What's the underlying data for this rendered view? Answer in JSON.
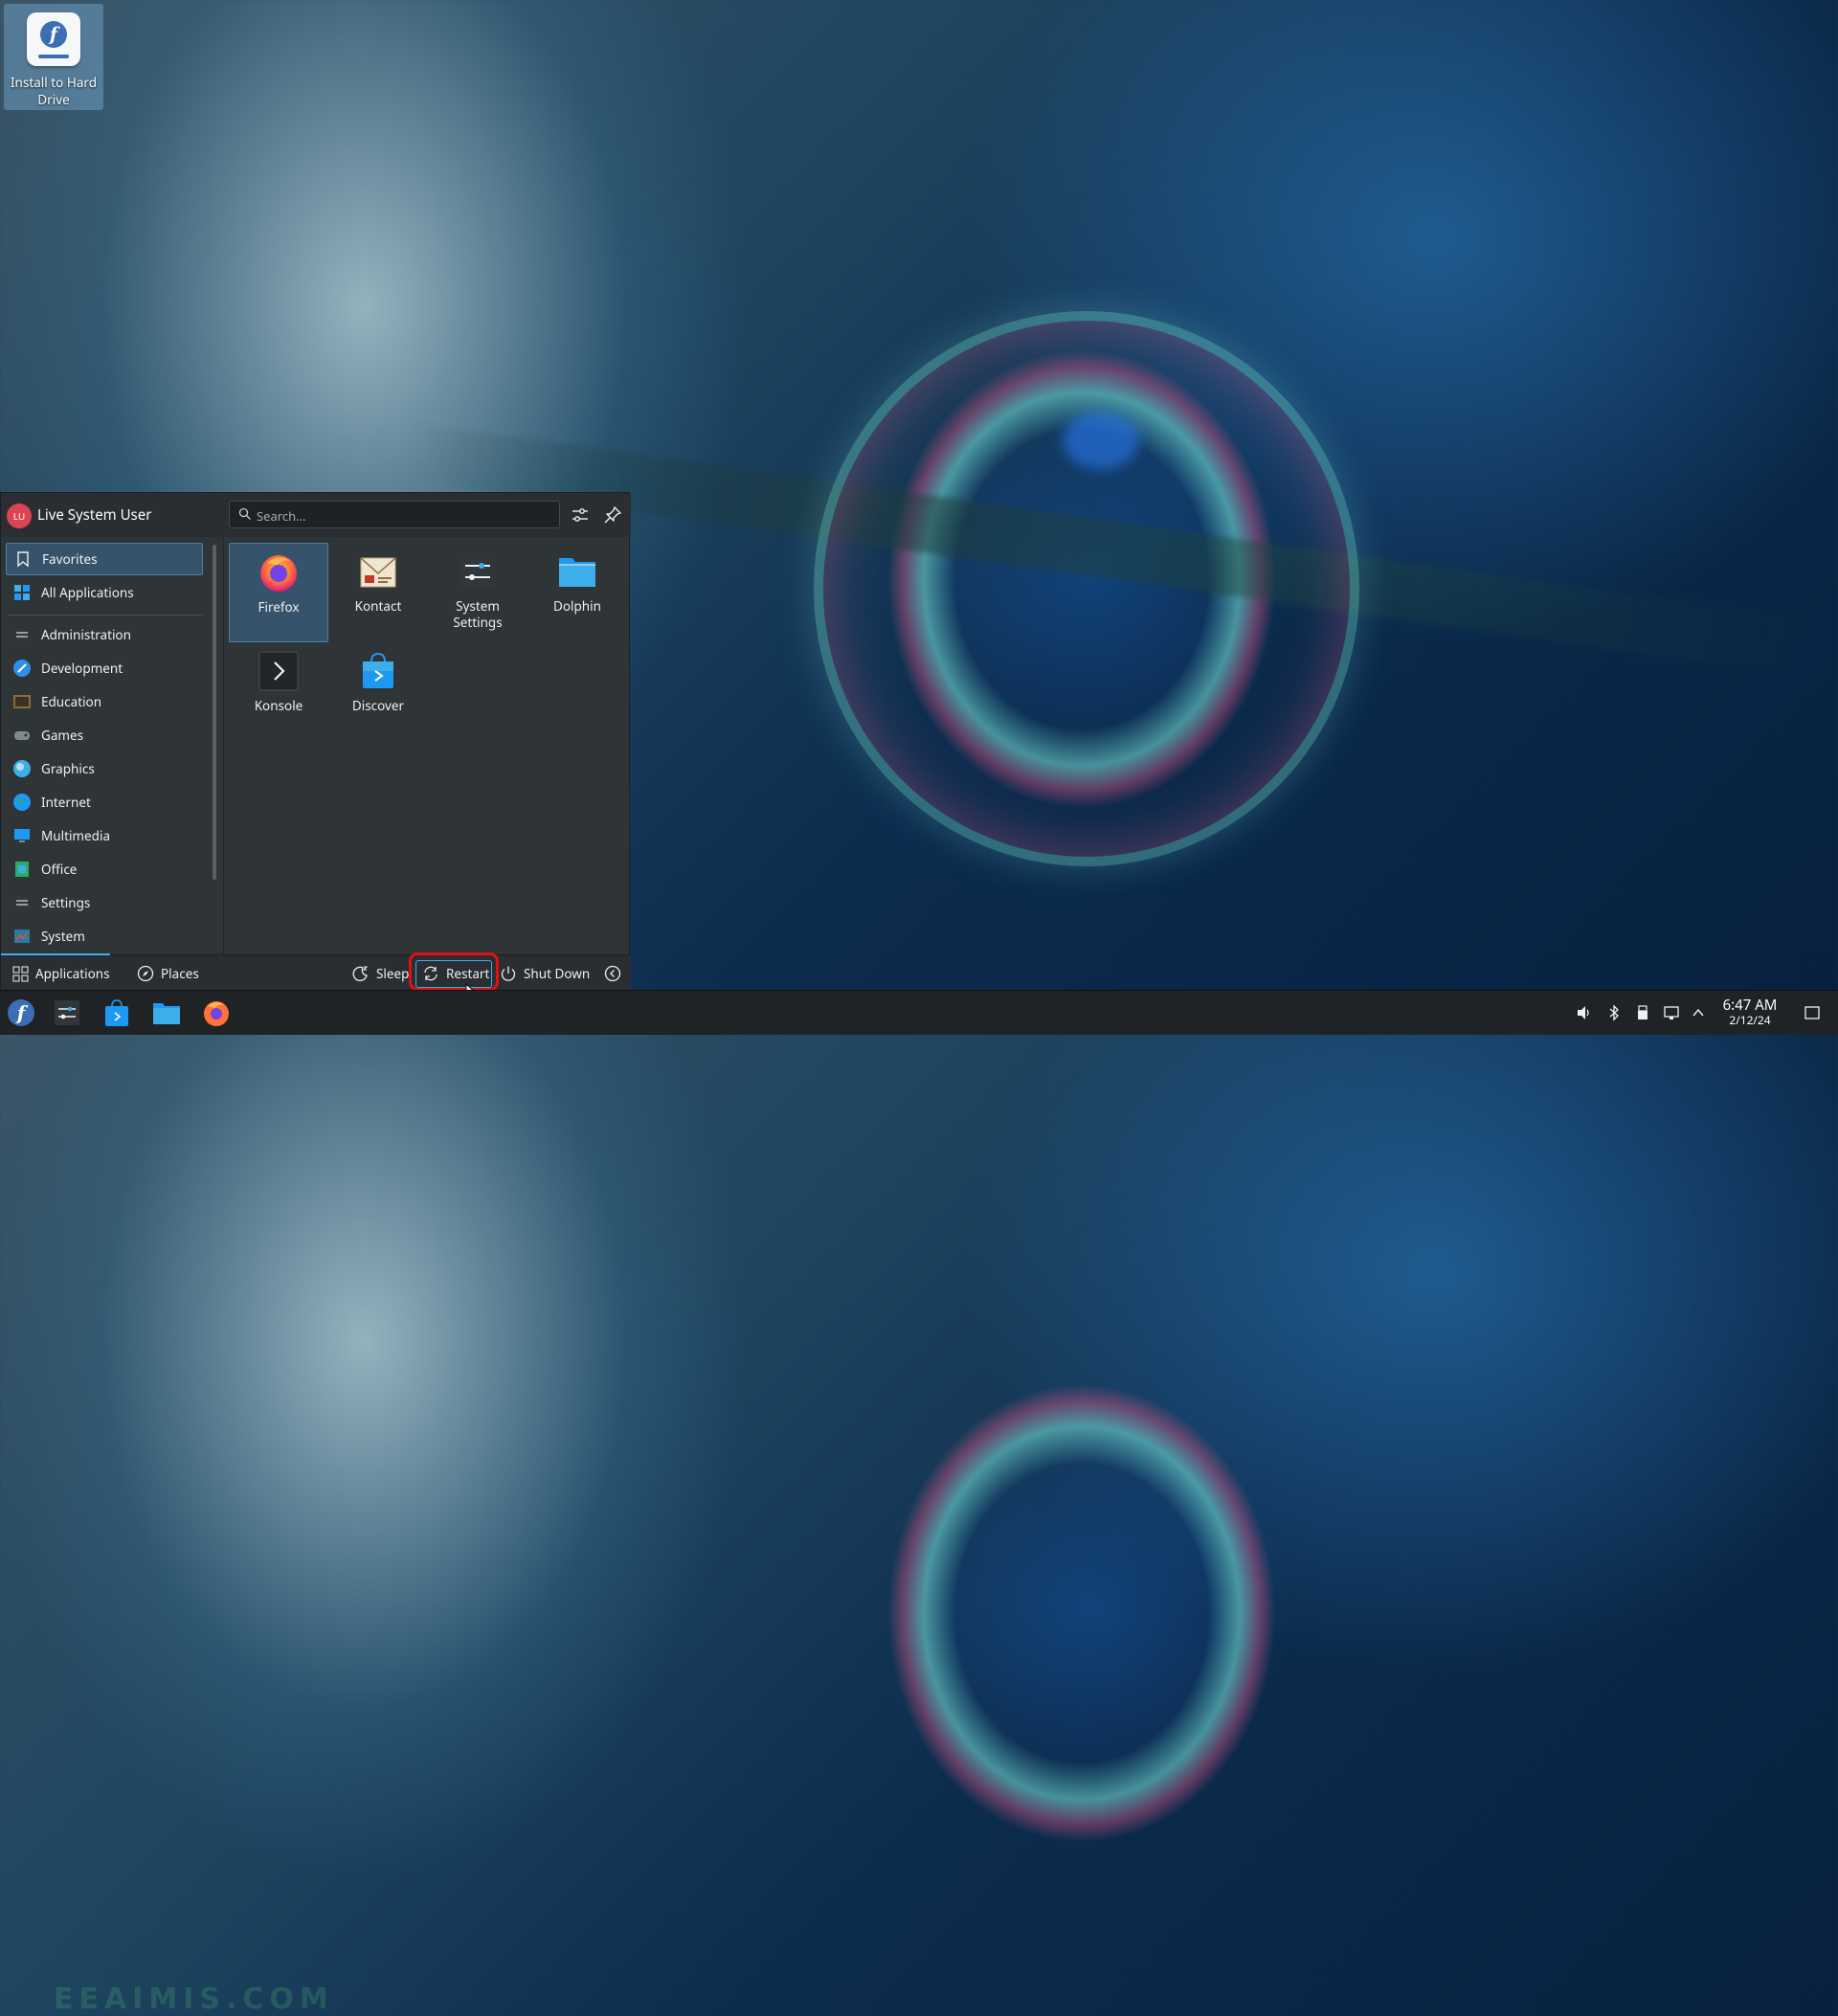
{
  "desktop": {
    "icons": [
      {
        "label": "Install to Hard Drive"
      }
    ]
  },
  "launcher": {
    "user": {
      "initials": "LU",
      "name": "Live System User"
    },
    "search": {
      "placeholder": "Search..."
    },
    "sidebar": {
      "items": [
        {
          "label": "Favorites",
          "icon": "bookmark-icon",
          "active": true
        },
        {
          "label": "All Applications",
          "icon": "grid-icon"
        },
        {
          "label": "Administration",
          "icon": "admin-icon"
        },
        {
          "label": "Development",
          "icon": "development-icon"
        },
        {
          "label": "Education",
          "icon": "education-icon"
        },
        {
          "label": "Games",
          "icon": "gamepad-icon"
        },
        {
          "label": "Graphics",
          "icon": "graphics-icon"
        },
        {
          "label": "Internet",
          "icon": "globe-icon"
        },
        {
          "label": "Multimedia",
          "icon": "multimedia-icon"
        },
        {
          "label": "Office",
          "icon": "office-icon"
        },
        {
          "label": "Settings",
          "icon": "settings-icon"
        },
        {
          "label": "System",
          "icon": "system-icon"
        }
      ]
    },
    "favorites": [
      {
        "label": "Firefox",
        "icon": "firefox-icon",
        "active": true
      },
      {
        "label": "Kontact",
        "icon": "kontact-icon"
      },
      {
        "label": "System Settings",
        "icon": "system-settings-icon"
      },
      {
        "label": "Dolphin",
        "icon": "dolphin-folder-icon"
      },
      {
        "label": "Konsole",
        "icon": "konsole-icon"
      },
      {
        "label": "Discover",
        "icon": "discover-icon"
      }
    ],
    "footer": {
      "applications": "Applications",
      "places": "Places",
      "sleep": "Sleep",
      "restart": "Restart",
      "shutdown": "Shut Down"
    }
  },
  "taskbar": {
    "clock": {
      "time": "6:47 AM",
      "date": "2/12/24"
    },
    "watermark": "EEAIMIS.COM",
    "accent_color": "#3daee9"
  }
}
